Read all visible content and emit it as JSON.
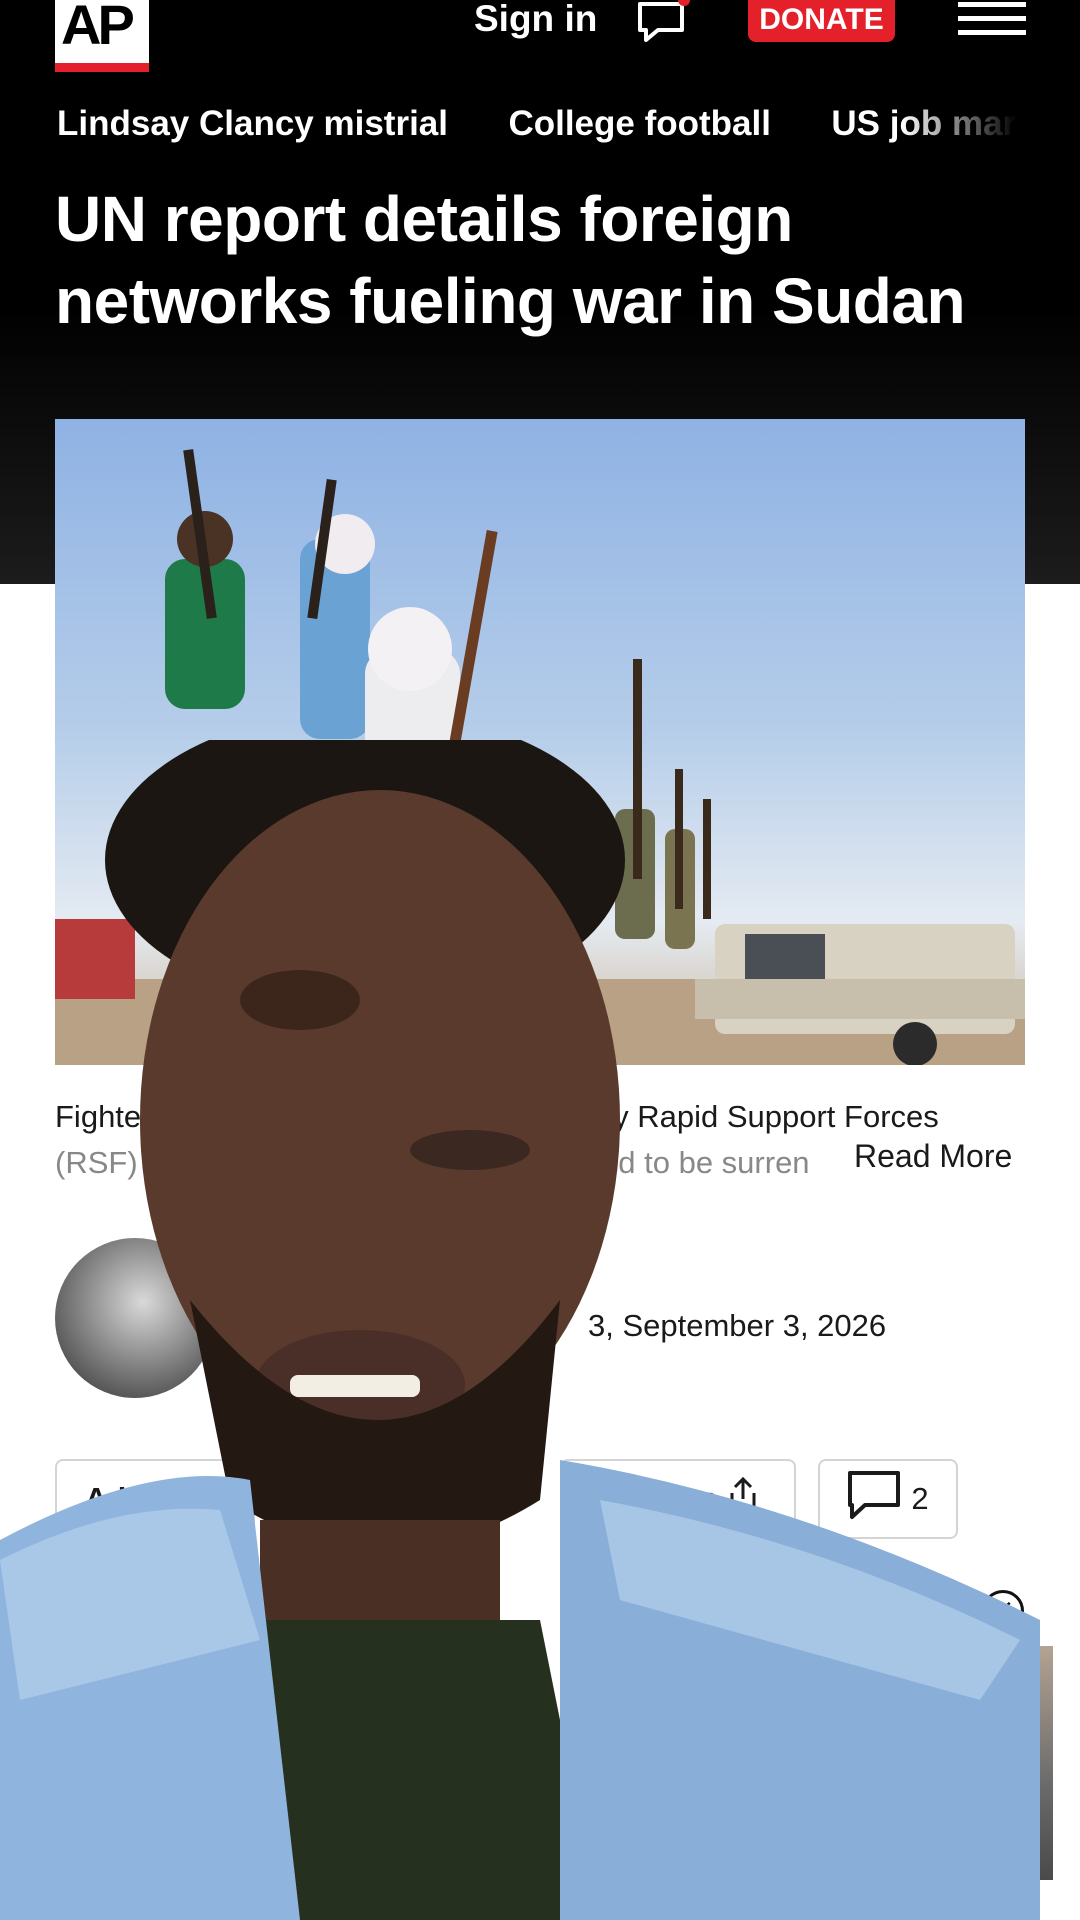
{
  "header": {
    "logo_text": "AP",
    "signin_label": "Sign in",
    "donate_label": "DONATE",
    "colors": {
      "brand_red": "#e4212b",
      "background": "#000000"
    }
  },
  "trending": [
    "Lindsay Clancy mistrial",
    "College football",
    "US job marke"
  ],
  "article": {
    "headline": "UN report details foreign networks fueling war in Sudan",
    "caption_line1": "Fighters                                              litary Rapid Support Forces",
    "caption_line2": "(RSF)                                                  eved to be surren",
    "read_more": "Read More",
    "dateline": "3, September 3, 2026"
  },
  "actions": {
    "add_label": "Ad",
    "share_label": "hare",
    "comments_count": "2"
  },
  "icons": {
    "chat": "chat-bubble-icon",
    "menu": "hamburger-menu-icon",
    "share": "share-icon",
    "comment": "comment-icon",
    "close": "close-icon"
  }
}
